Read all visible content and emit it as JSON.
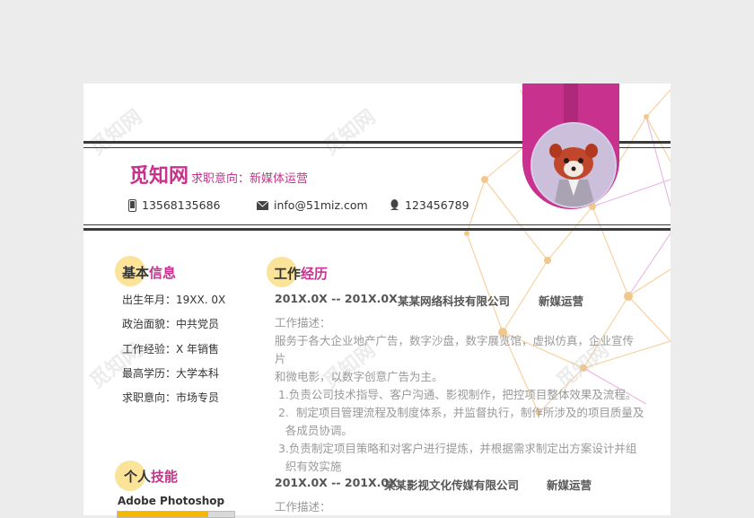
{
  "watermark": "觅知网",
  "header": {
    "name": "觅知网",
    "intent_line": "求职意向：新媒体运营",
    "phone": "13568135686",
    "email": "info@51miz.com",
    "qq": "123456789"
  },
  "basic": {
    "title_a": "基本",
    "title_b": "信息",
    "items": [
      "出生年月：19XX. 0X",
      "政治面貌：中共党员",
      "工作经验：X 年销售",
      "最高学历：大学本科",
      "求职意向：市场专员"
    ]
  },
  "skills": {
    "title_a": "个人",
    "title_b": "技能",
    "items": [
      {
        "name": "Adobe Photoshop",
        "level": 0.78
      }
    ]
  },
  "work": {
    "title_a": "工作",
    "title_b": "经历",
    "jobs": [
      {
        "period": "201X.0X -- 201X.0X",
        "company": "某某网络科技有限公司",
        "role": "新媒运营",
        "desc_label": "工作描述：",
        "lines": [
          "服务于各大企业地产广告，数字沙盘，数字展览馆，虚拟仿真，企业宣传片",
          "和微电影，以数字创意广告为主。",
          " 1.负责公司技术指导、客户沟通、影视制作，把控项目整体效果及流程。",
          " 2.  制定项目管理流程及制度体系，并监督执行，制作所涉及的项目质量及",
          "   各成员协调。",
          " 3.负责制定项目策略和对客户进行提炼，并根据需求制定出方案设计并组",
          "   织有效实施"
        ]
      },
      {
        "period": "201X.0X -- 201X.0X",
        "company": "某某影视文化传媒有限公司",
        "role": "新媒运营",
        "desc_label": "工作描述："
      }
    ]
  }
}
